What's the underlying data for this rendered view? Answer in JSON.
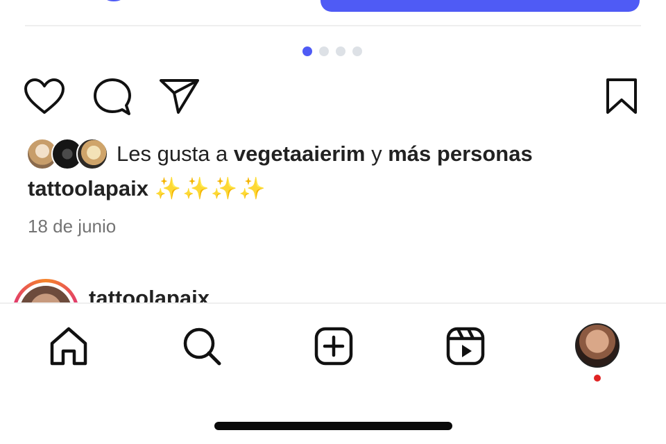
{
  "carousel": {
    "count": 4,
    "active_index": 0
  },
  "accent_color": "#4f5bf5",
  "actions": {
    "like_icon": "heart-icon",
    "comment_icon": "comment-bubble-icon",
    "share_icon": "paper-plane-icon",
    "save_icon": "bookmark-icon"
  },
  "likes": {
    "prefix": "Les gusta a",
    "user": "vegetaaierim",
    "connector": "y",
    "others": "más personas"
  },
  "caption": {
    "username": "tattoolapaix",
    "text": "✨✨✨✨"
  },
  "date": "18 de junio",
  "next_post": {
    "username": "tattoolapaix"
  },
  "bottom_nav": {
    "items": [
      "home-icon",
      "search-icon",
      "create-icon",
      "reels-icon",
      "profile-avatar"
    ],
    "notification_dot_color": "#e02424"
  }
}
